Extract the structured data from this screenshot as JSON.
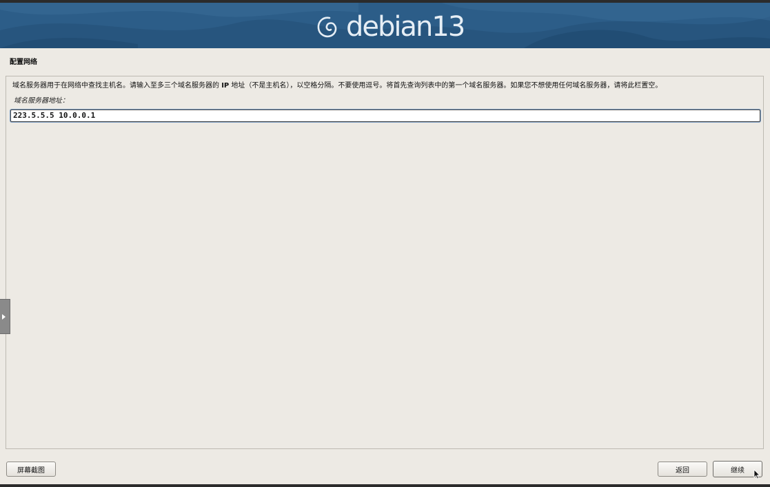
{
  "banner": {
    "brand_text": "debian",
    "brand_version": "13",
    "colors": {
      "background": "#2c5d88",
      "text": "#e6eef5"
    }
  },
  "page": {
    "title": "配置网络",
    "description_before": "域名服务器用于在网络中查找主机名。请输入至多三个域名服务器的 ",
    "description_ip": "IP",
    "description_after": " 地址（不是主机名），以空格分隔。不要使用逗号。将首先查询列表中的第一个域名服务器。如果您不想使用任何域名服务器，请将此栏置空。"
  },
  "dns_field": {
    "label": "域名服务器地址：",
    "value": "223.5.5.5 10.0.0.1"
  },
  "side_tab": {
    "icon": "play-triangle-icon"
  },
  "buttons": {
    "screenshot": "屏幕截图",
    "back": "返回",
    "continue": "继续"
  },
  "cursor": {
    "icon": "mouse-pointer-icon"
  }
}
